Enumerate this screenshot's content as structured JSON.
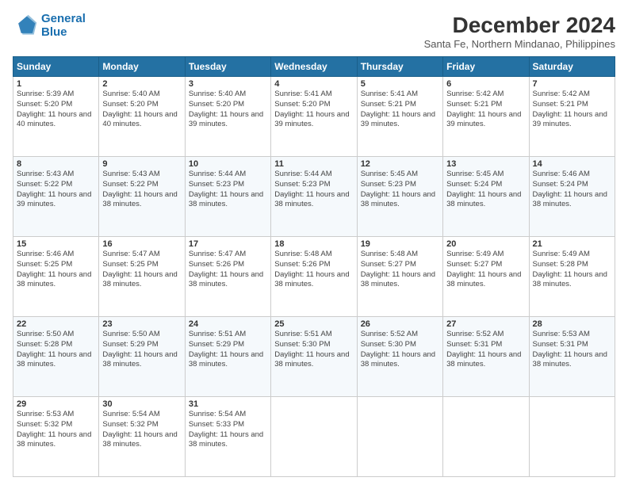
{
  "header": {
    "logo_line1": "General",
    "logo_line2": "Blue",
    "main_title": "December 2024",
    "subtitle": "Santa Fe, Northern Mindanao, Philippines"
  },
  "calendar": {
    "days_of_week": [
      "Sunday",
      "Monday",
      "Tuesday",
      "Wednesday",
      "Thursday",
      "Friday",
      "Saturday"
    ],
    "weeks": [
      [
        null,
        {
          "day": 2,
          "sunrise": "5:40 AM",
          "sunset": "5:20 PM",
          "daylight": "11 hours and 40 minutes."
        },
        {
          "day": 3,
          "sunrise": "5:40 AM",
          "sunset": "5:20 PM",
          "daylight": "11 hours and 39 minutes."
        },
        {
          "day": 4,
          "sunrise": "5:41 AM",
          "sunset": "5:20 PM",
          "daylight": "11 hours and 39 minutes."
        },
        {
          "day": 5,
          "sunrise": "5:41 AM",
          "sunset": "5:21 PM",
          "daylight": "11 hours and 39 minutes."
        },
        {
          "day": 6,
          "sunrise": "5:42 AM",
          "sunset": "5:21 PM",
          "daylight": "11 hours and 39 minutes."
        },
        {
          "day": 7,
          "sunrise": "5:42 AM",
          "sunset": "5:21 PM",
          "daylight": "11 hours and 39 minutes."
        }
      ],
      [
        {
          "day": 1,
          "sunrise": "5:39 AM",
          "sunset": "5:20 PM",
          "daylight": "11 hours and 40 minutes."
        },
        null,
        null,
        null,
        null,
        null,
        null
      ],
      [
        {
          "day": 8,
          "sunrise": "5:43 AM",
          "sunset": "5:22 PM",
          "daylight": "11 hours and 39 minutes."
        },
        {
          "day": 9,
          "sunrise": "5:43 AM",
          "sunset": "5:22 PM",
          "daylight": "11 hours and 38 minutes."
        },
        {
          "day": 10,
          "sunrise": "5:44 AM",
          "sunset": "5:23 PM",
          "daylight": "11 hours and 38 minutes."
        },
        {
          "day": 11,
          "sunrise": "5:44 AM",
          "sunset": "5:23 PM",
          "daylight": "11 hours and 38 minutes."
        },
        {
          "day": 12,
          "sunrise": "5:45 AM",
          "sunset": "5:23 PM",
          "daylight": "11 hours and 38 minutes."
        },
        {
          "day": 13,
          "sunrise": "5:45 AM",
          "sunset": "5:24 PM",
          "daylight": "11 hours and 38 minutes."
        },
        {
          "day": 14,
          "sunrise": "5:46 AM",
          "sunset": "5:24 PM",
          "daylight": "11 hours and 38 minutes."
        }
      ],
      [
        {
          "day": 15,
          "sunrise": "5:46 AM",
          "sunset": "5:25 PM",
          "daylight": "11 hours and 38 minutes."
        },
        {
          "day": 16,
          "sunrise": "5:47 AM",
          "sunset": "5:25 PM",
          "daylight": "11 hours and 38 minutes."
        },
        {
          "day": 17,
          "sunrise": "5:47 AM",
          "sunset": "5:26 PM",
          "daylight": "11 hours and 38 minutes."
        },
        {
          "day": 18,
          "sunrise": "5:48 AM",
          "sunset": "5:26 PM",
          "daylight": "11 hours and 38 minutes."
        },
        {
          "day": 19,
          "sunrise": "5:48 AM",
          "sunset": "5:27 PM",
          "daylight": "11 hours and 38 minutes."
        },
        {
          "day": 20,
          "sunrise": "5:49 AM",
          "sunset": "5:27 PM",
          "daylight": "11 hours and 38 minutes."
        },
        {
          "day": 21,
          "sunrise": "5:49 AM",
          "sunset": "5:28 PM",
          "daylight": "11 hours and 38 minutes."
        }
      ],
      [
        {
          "day": 22,
          "sunrise": "5:50 AM",
          "sunset": "5:28 PM",
          "daylight": "11 hours and 38 minutes."
        },
        {
          "day": 23,
          "sunrise": "5:50 AM",
          "sunset": "5:29 PM",
          "daylight": "11 hours and 38 minutes."
        },
        {
          "day": 24,
          "sunrise": "5:51 AM",
          "sunset": "5:29 PM",
          "daylight": "11 hours and 38 minutes."
        },
        {
          "day": 25,
          "sunrise": "5:51 AM",
          "sunset": "5:30 PM",
          "daylight": "11 hours and 38 minutes."
        },
        {
          "day": 26,
          "sunrise": "5:52 AM",
          "sunset": "5:30 PM",
          "daylight": "11 hours and 38 minutes."
        },
        {
          "day": 27,
          "sunrise": "5:52 AM",
          "sunset": "5:31 PM",
          "daylight": "11 hours and 38 minutes."
        },
        {
          "day": 28,
          "sunrise": "5:53 AM",
          "sunset": "5:31 PM",
          "daylight": "11 hours and 38 minutes."
        }
      ],
      [
        {
          "day": 29,
          "sunrise": "5:53 AM",
          "sunset": "5:32 PM",
          "daylight": "11 hours and 38 minutes."
        },
        {
          "day": 30,
          "sunrise": "5:54 AM",
          "sunset": "5:32 PM",
          "daylight": "11 hours and 38 minutes."
        },
        {
          "day": 31,
          "sunrise": "5:54 AM",
          "sunset": "5:33 PM",
          "daylight": "11 hours and 38 minutes."
        },
        null,
        null,
        null,
        null
      ]
    ]
  }
}
